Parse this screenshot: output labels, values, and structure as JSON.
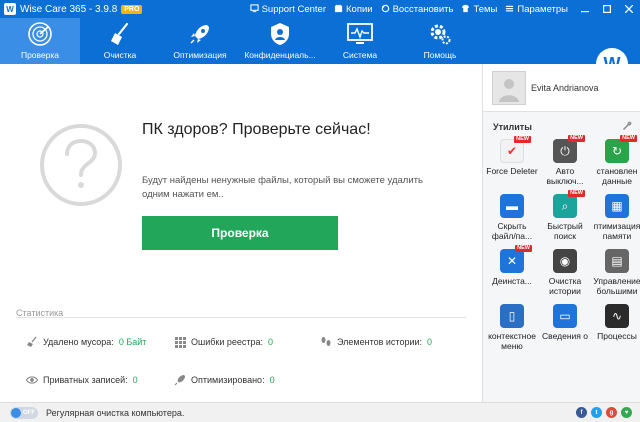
{
  "window": {
    "title": "Wise Care 365 - 3.9.8",
    "badge": "PRO",
    "logo_letter": "W"
  },
  "top_links": [
    {
      "icon": "support-icon",
      "label": "Support Center"
    },
    {
      "icon": "copy-icon",
      "label": "Копии"
    },
    {
      "icon": "restore-icon",
      "label": "Восстановить"
    },
    {
      "icon": "shirt-icon",
      "label": "Темы"
    },
    {
      "icon": "menu-icon",
      "label": "Параметры"
    }
  ],
  "nav": [
    {
      "id": "scan",
      "label": "Проверка",
      "icon": "radar-icon",
      "active": true
    },
    {
      "id": "clean",
      "label": "Очистка",
      "icon": "broom-icon",
      "active": false
    },
    {
      "id": "optimize",
      "label": "Оптимизация",
      "icon": "rocket-icon",
      "active": false
    },
    {
      "id": "privacy",
      "label": "Конфиденциаль...",
      "icon": "shield-icon",
      "active": false
    },
    {
      "id": "system",
      "label": "Система",
      "icon": "monitor-icon",
      "active": false
    },
    {
      "id": "help",
      "label": "Помощь",
      "icon": "gear-icon",
      "active": false
    }
  ],
  "user": {
    "initial": "W",
    "name": "Evita Andrianova"
  },
  "main": {
    "heading": "ПК здоров? Проверьте сейчас!",
    "description": "Будут найдены ненужные файлы, который вы сможете удалить одним нажати ем..",
    "scan_button": "Проверка"
  },
  "stats": {
    "title": "Статистика",
    "items": [
      {
        "icon": "broom-small-icon",
        "label": "Удалено мусора:",
        "value": "0 Байт"
      },
      {
        "icon": "grid-icon",
        "label": "Ошибки реестра:",
        "value": "0"
      },
      {
        "icon": "footprint-icon",
        "label": "Элементов истории:",
        "value": "0"
      },
      {
        "icon": "eye-icon",
        "label": "Приватных записей:",
        "value": "0"
      },
      {
        "icon": "rocket-small-icon",
        "label": "Оптимизировано:",
        "value": "0"
      }
    ]
  },
  "utilities": {
    "title": "Утилиты",
    "tools": [
      {
        "label": "Force Deleter",
        "icon": "force-deleter-icon",
        "color": "#f2f2f2",
        "glyph": "✔",
        "new": true,
        "new_label": "NEW"
      },
      {
        "label": "Авто выключ...",
        "icon": "power-icon",
        "color": "#555555",
        "glyph": "⏻",
        "new": true,
        "new_label": "NEW"
      },
      {
        "label": "становлен данные",
        "icon": "recover-icon",
        "color": "#2aa44a",
        "glyph": "↻",
        "new": true,
        "new_label": "NEW"
      },
      {
        "label": "Скрыть файл/па...",
        "icon": "folder-icon",
        "color": "#1e74d8",
        "glyph": "▬",
        "new": false
      },
      {
        "label": "Быстрый поиск",
        "icon": "search-icon",
        "color": "#1ba39c",
        "glyph": "⌕",
        "new": true,
        "new_label": "NEW"
      },
      {
        "label": "птимизация памяти",
        "icon": "memory-icon",
        "color": "#1e74d8",
        "glyph": "▦",
        "new": false
      },
      {
        "label": "Деинста...",
        "icon": "uninstall-icon",
        "color": "#1e74d8",
        "glyph": "✕",
        "new": true,
        "new_label": "NEW"
      },
      {
        "label": "Очистка истории",
        "icon": "eye-off-icon",
        "color": "#444444",
        "glyph": "◉",
        "new": false
      },
      {
        "label": "Управление большими",
        "icon": "big-files-icon",
        "color": "#666666",
        "glyph": "▤",
        "new": false
      },
      {
        "label": "контекстное меню",
        "icon": "mouse-icon",
        "color": "#2a6fc4",
        "glyph": "▯",
        "new": false
      },
      {
        "label": "Сведения о",
        "icon": "system-info-icon",
        "color": "#1e74d8",
        "glyph": "▭",
        "new": false
      },
      {
        "label": "Процессы",
        "icon": "process-icon",
        "color": "#2b2b2b",
        "glyph": "∿",
        "new": false
      }
    ]
  },
  "status": {
    "toggle_label": "OFF",
    "text": "Регулярная очистка компьютера."
  },
  "socials": [
    {
      "icon": "facebook-icon",
      "letter": "f",
      "color": "#3b5998"
    },
    {
      "icon": "twitter-icon",
      "letter": "t",
      "color": "#1da1f2"
    },
    {
      "icon": "google-plus-icon",
      "letter": "g",
      "color": "#dd4b39"
    },
    {
      "icon": "like-icon",
      "letter": "♥",
      "color": "#34a853"
    }
  ],
  "colors": {
    "brand_blue": "#0b6fd6",
    "nav_active": "#3a8ee6",
    "scan_green": "#22a75a"
  }
}
